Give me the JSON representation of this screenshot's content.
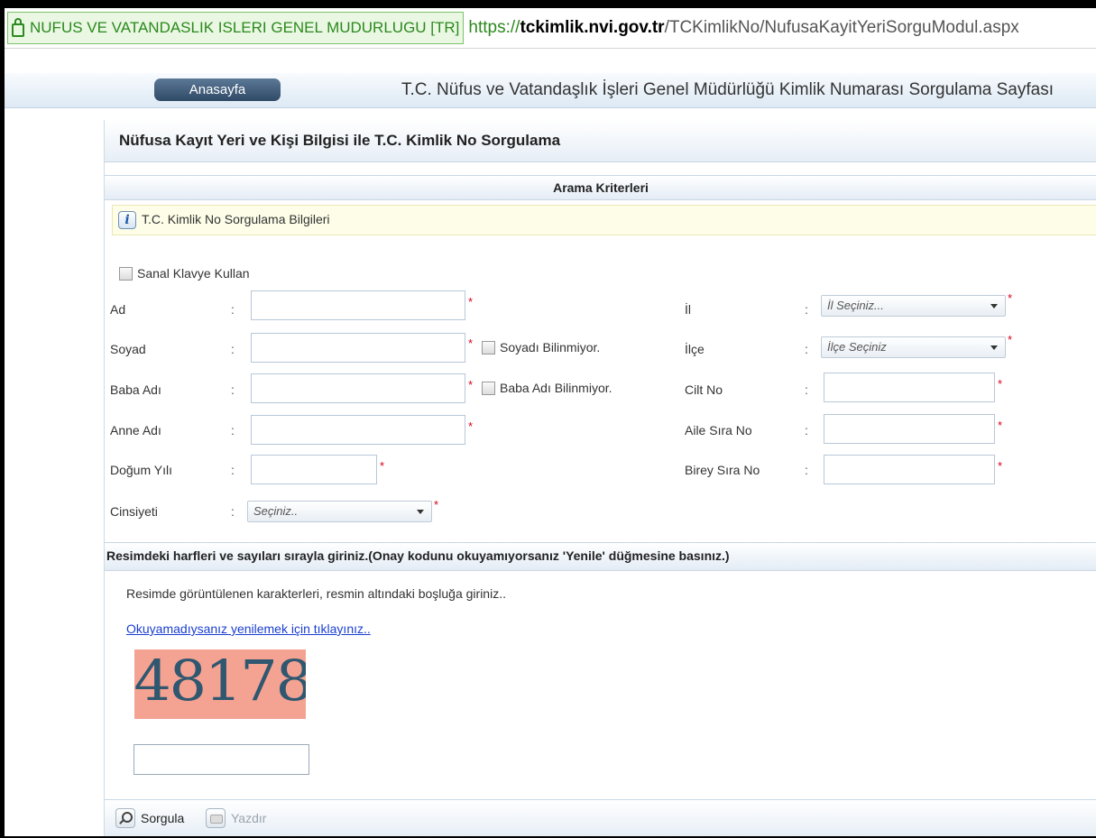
{
  "browser": {
    "cert_label": "NUFUS VE VATANDASLIK ISLERI GENEL MUDURLUGU [TR]",
    "url_scheme": "https://",
    "url_host": "tckimlik.nvi.gov.tr",
    "url_path": "/TCKimlikNo/NufusaKayitYeriSorguModul.aspx"
  },
  "site": {
    "home_button": "Anasayfa",
    "title": "T.C. Nüfus ve Vatandaşlık İşleri Genel Müdürlüğü Kimlik Numarası Sorgulama Sayfası"
  },
  "panel": {
    "title": "Nüfusa Kayıt Yeri ve Kişi Bilgisi ile T.C. Kimlik No Sorgulama",
    "criteria_header": "Arama Kriterleri",
    "info_text": "T.C. Kimlik No Sorgulama Bilgileri",
    "virtual_keyboard": "Sanal Klavye Kullan"
  },
  "form": {
    "colon": ":",
    "required_mark": "*",
    "left": {
      "ad": "Ad",
      "soyad": "Soyad",
      "baba_adi": "Baba Adı",
      "anne_adi": "Anne Adı",
      "dogum_yili": "Doğum Yılı",
      "cinsiyet": "Cinsiyeti",
      "cinsiyet_value": "Seçiniz..",
      "soyadi_bilinmiyor": "Soyadı Bilinmiyor.",
      "baba_adi_bilinmiyor": "Baba Adı Bilinmiyor."
    },
    "right": {
      "il": "İl",
      "il_value": "İl Seçiniz...",
      "ilce": "İlçe",
      "ilce_value": "İlçe Seçiniz",
      "cilt_no": "Cilt No",
      "aile_sira_no": "Aile Sıra No",
      "birey_sira_no": "Birey Sıra No"
    }
  },
  "captcha": {
    "header": "Resimdeki harfleri ve sayıları sırayla giriniz.(Onay kodunu okuyamıyorsanız 'Yenile' düğmesine basınız.)",
    "instruction": "Resimde görüntülenen karakterleri, resmin altındaki boşluğa giriniz..",
    "refresh_link": "Okuyamadıysanız yenilemek için tıklayınız..",
    "image_text": "48178",
    "input_value": ""
  },
  "footer": {
    "query_button": "Sorgula",
    "print_button": "Yazdır"
  }
}
